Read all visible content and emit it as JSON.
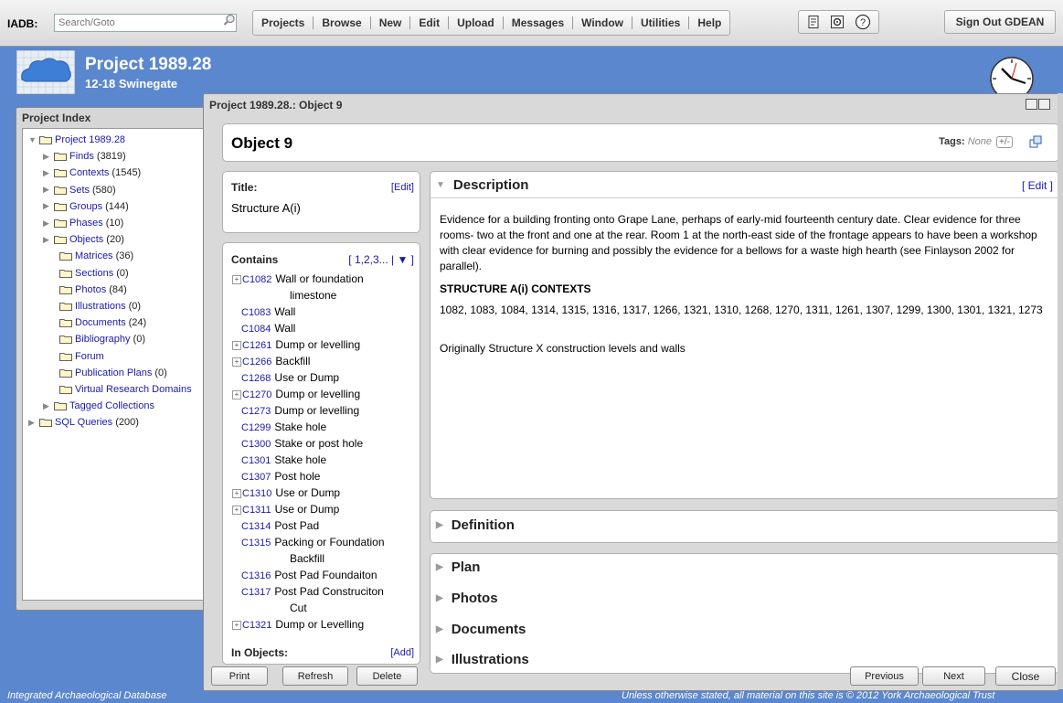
{
  "topbar": {
    "iadb_label": "IADB:",
    "search_placeholder": "Search/Goto",
    "menu": [
      "Projects",
      "Browse",
      "New",
      "Edit",
      "Upload",
      "Messages",
      "Window",
      "Utilities",
      "Help"
    ],
    "sign_out": "Sign Out GDEAN"
  },
  "header": {
    "project_title": "Project 1989.28",
    "project_subtitle": "12-18 Swinegate"
  },
  "left": {
    "header": "Project Index",
    "tree": [
      {
        "label": "Project 1989.28",
        "count": "",
        "indent": 0,
        "arrow": "down"
      },
      {
        "label": "Finds",
        "count": "(3819)",
        "indent": 1,
        "arrow": "right"
      },
      {
        "label": "Contexts",
        "count": "(1545)",
        "indent": 1,
        "arrow": "right"
      },
      {
        "label": "Sets",
        "count": "(580)",
        "indent": 1,
        "arrow": "right"
      },
      {
        "label": "Groups",
        "count": "(144)",
        "indent": 1,
        "arrow": "right"
      },
      {
        "label": "Phases",
        "count": "(10)",
        "indent": 1,
        "arrow": "right"
      },
      {
        "label": "Objects",
        "count": "(20)",
        "indent": 1,
        "arrow": "right"
      },
      {
        "label": "Matrices",
        "count": "(36)",
        "indent": 2,
        "arrow": ""
      },
      {
        "label": "Sections",
        "count": "(0)",
        "indent": 2,
        "arrow": ""
      },
      {
        "label": "Photos",
        "count": "(84)",
        "indent": 2,
        "arrow": ""
      },
      {
        "label": "Illustrations",
        "count": "(0)",
        "indent": 2,
        "arrow": ""
      },
      {
        "label": "Documents",
        "count": "(24)",
        "indent": 2,
        "arrow": ""
      },
      {
        "label": "Bibliography",
        "count": "(0)",
        "indent": 2,
        "arrow": ""
      },
      {
        "label": "Forum",
        "count": "",
        "indent": 2,
        "arrow": ""
      },
      {
        "label": "Publication Plans",
        "count": "(0)",
        "indent": 2,
        "arrow": ""
      },
      {
        "label": "Virtual Research Domains",
        "count": "",
        "indent": 2,
        "arrow": ""
      },
      {
        "label": "Tagged Collections",
        "count": "",
        "indent": 1,
        "arrow": "right"
      },
      {
        "label": "SQL Queries",
        "count": "(200)",
        "indent": 0,
        "arrow": "right"
      }
    ]
  },
  "window": {
    "title": "Project 1989.28.: Object 9",
    "object_title": "Object 9",
    "tags_label": "Tags:",
    "tags_value": "None",
    "tags_button": "+/-",
    "title_label": "Title:",
    "title_edit": "[Edit]",
    "title_value": "Structure A(i)",
    "contains_label": "Contains",
    "contains_paging": "[ 1,2,3... | ▼ ]",
    "contains": [
      {
        "code": "C1082",
        "text": "Wall or foundation",
        "cont": "limestone",
        "plus": true
      },
      {
        "code": "C1083",
        "text": "Wall",
        "cont": "",
        "plus": false
      },
      {
        "code": "C1084",
        "text": "Wall",
        "cont": "",
        "plus": false
      },
      {
        "code": "C1261",
        "text": "Dump or levelling",
        "cont": "",
        "plus": true
      },
      {
        "code": "C1266",
        "text": "Backfill",
        "cont": "",
        "plus": true
      },
      {
        "code": "C1268",
        "text": "Use or Dump",
        "cont": "",
        "plus": false
      },
      {
        "code": "C1270",
        "text": "Dump or levelling",
        "cont": "",
        "plus": true
      },
      {
        "code": "C1273",
        "text": "Dump or levelling",
        "cont": "",
        "plus": false
      },
      {
        "code": "C1299",
        "text": "Stake hole",
        "cont": "",
        "plus": false
      },
      {
        "code": "C1300",
        "text": "Stake or post hole",
        "cont": "",
        "plus": false
      },
      {
        "code": "C1301",
        "text": "Stake hole",
        "cont": "",
        "plus": false
      },
      {
        "code": "C1307",
        "text": "Post hole",
        "cont": "",
        "plus": false
      },
      {
        "code": "C1310",
        "text": "Use or Dump",
        "cont": "",
        "plus": true
      },
      {
        "code": "C1311",
        "text": "Use or Dump",
        "cont": "",
        "plus": true
      },
      {
        "code": "C1314",
        "text": "Post Pad",
        "cont": "",
        "plus": false
      },
      {
        "code": "C1315",
        "text": "Packing or Foundation",
        "cont": "Backfill",
        "plus": false
      },
      {
        "code": "C1316",
        "text": "Post Pad Foundaiton",
        "cont": "",
        "plus": false
      },
      {
        "code": "C1317",
        "text": "Post Pad Construciton",
        "cont": "Cut",
        "plus": false
      },
      {
        "code": "C1321",
        "text": "Dump or Levelling",
        "cont": "",
        "plus": true
      }
    ],
    "in_objects_label": "In Objects:",
    "in_objects_add": "[Add]",
    "description": {
      "heading": "Description",
      "edit": "[ Edit ]",
      "para": " Evidence for a building fronting onto Grape Lane, perhaps of early-mid fourteenth century date. Clear evidence for three rooms- two at the front and one at the rear. Room 1 at the north-east side of the frontage appears to have been a workshop with clear evidence for burning and possibly the evidence for a bellows for a waste high hearth (see Finlayson 2002 for parallel).",
      "contexts_heading": "STRUCTURE A(i) CONTEXTS",
      "contexts_list": "1082, 1083, 1084, 1314, 1315, 1316, 1317, 1266, 1321, 1310, 1268, 1270, 1311, 1261, 1307, 1299, 1300, 1301, 1321, 1273",
      "note": "Originally Structure X construction levels and walls"
    },
    "sections": [
      "Definition",
      "Plan",
      "Photos",
      "Documents",
      "Illustrations"
    ],
    "buttons": {
      "print": "Print",
      "refresh": "Refresh",
      "delete": "Delete",
      "previous": "Previous",
      "next": "Next",
      "close": "Close"
    }
  },
  "footer": {
    "left": "Integrated Archaeological Database",
    "right": "Unless otherwise stated, all material on this site is © 2012 York Archaeological Trust"
  },
  "colors": {
    "background": "#5b87cf",
    "link": "#1a1aaa"
  }
}
